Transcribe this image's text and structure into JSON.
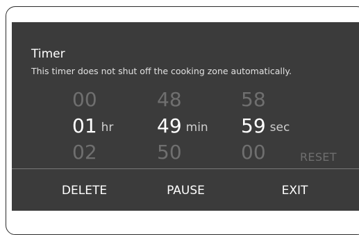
{
  "timer": {
    "title": "Timer",
    "subtitle": "This timer does not shut off the cooking zone automatically.",
    "hours": {
      "prev": "00",
      "value": "01",
      "next": "02",
      "unit": "hr"
    },
    "minutes": {
      "prev": "48",
      "value": "49",
      "next": "50",
      "unit": "min"
    },
    "seconds": {
      "prev": "58",
      "value": "59",
      "next": "00",
      "unit": "sec"
    },
    "reset_label": "RESET"
  },
  "actions": {
    "delete_label": "DELETE",
    "pause_label": "PAUSE",
    "exit_label": "EXIT"
  },
  "colors": {
    "panel_bg": "#3b3b3b",
    "active_text": "#ffffff",
    "dim_text": "#6f6f6f"
  }
}
